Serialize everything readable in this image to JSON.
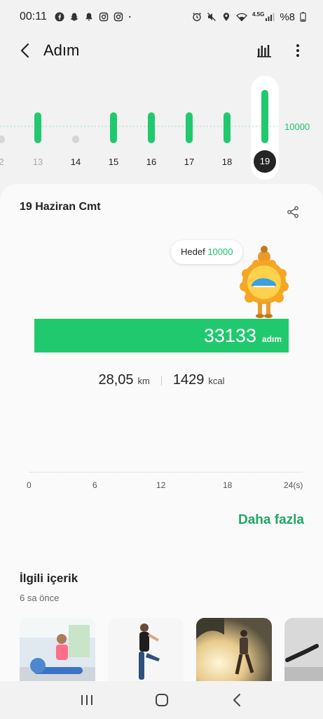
{
  "status_bar": {
    "time": "00:11",
    "battery": "%8",
    "network": "4.5G",
    "left_icons": [
      "facebook-icon",
      "snapchat-icon",
      "notification-bell-icon",
      "instagram-icon",
      "instagram-icon",
      "dot-icon"
    ],
    "right_icons": [
      "alarm-icon",
      "mute-icon",
      "location-icon",
      "wifi-icon",
      "signal-icon",
      "battery-icon"
    ]
  },
  "app_bar": {
    "title": "Adım",
    "icons": [
      "back-arrow-icon",
      "bar-chart-icon",
      "more-vert-icon"
    ]
  },
  "week_chart": {
    "goal_label": "10000",
    "days": [
      "2",
      "13",
      "14",
      "15",
      "16",
      "17",
      "18",
      "19"
    ],
    "selected_day": "19",
    "goal_reached": [
      false,
      true,
      false,
      true,
      true,
      true,
      true,
      true
    ],
    "accent_color": "#21c96e"
  },
  "day_detail": {
    "date": "19 Haziran Cmt",
    "goal_prefix": "Hedef",
    "goal_value": "10000",
    "steps": "33133",
    "steps_unit": "adım",
    "distance": "28,05",
    "distance_unit": "km",
    "calories": "1429",
    "calories_unit": "kcal",
    "hour_ticks": [
      "0",
      "6",
      "12",
      "18",
      "24(s)"
    ],
    "more_label": "Daha fazla"
  },
  "related": {
    "title": "İlgili içerik",
    "subtitle": "6 sa önce",
    "items": [
      "workout-thumbnail",
      "stretching-thumbnail",
      "running-thumbnail",
      "exercise-thumbnail"
    ]
  },
  "nav_bar": {
    "icons": [
      "recent-apps-icon",
      "home-icon",
      "back-icon"
    ]
  },
  "colors": {
    "accent": "#21c96e",
    "link": "#1fa864",
    "background": "#f2f2f2",
    "card": "#fafafa"
  }
}
